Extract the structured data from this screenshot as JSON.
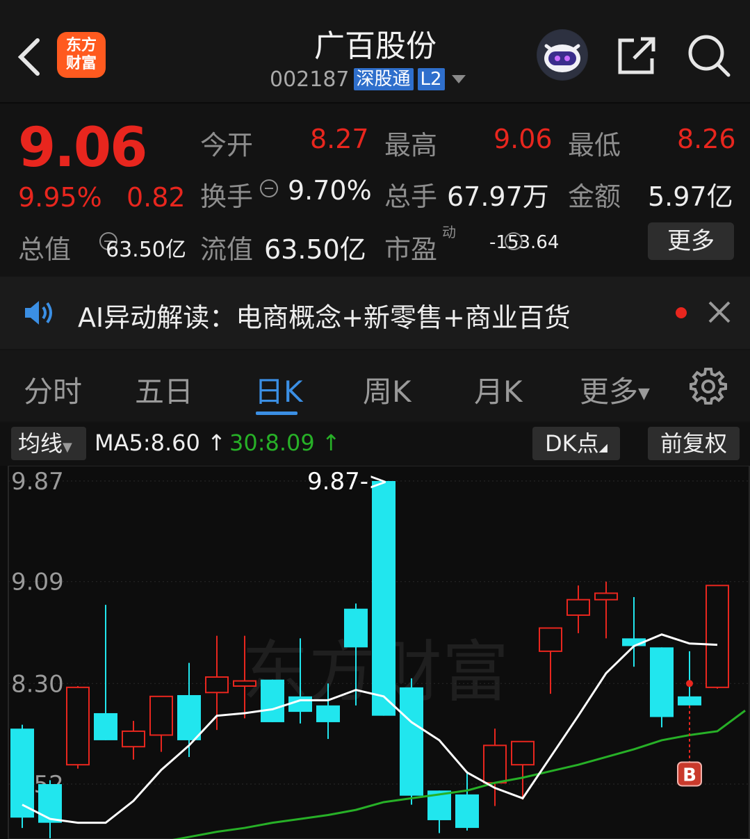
{
  "header": {
    "title": "广百股份",
    "code": "002187",
    "tag1": "深股通",
    "tag2": "L2",
    "logo_line1": "东方",
    "logo_line2": "财富"
  },
  "quote": {
    "price": "9.06",
    "change_pct": "9.95%",
    "change": "0.82",
    "open_label": "今开",
    "open": "8.27",
    "high_label": "最高",
    "high": "9.06",
    "low_label": "最低",
    "low": "8.26",
    "turnover_label": "换手",
    "turnover": "9.70%",
    "volume_label": "总手",
    "volume": "67.97万",
    "amount_label": "金额",
    "amount": "5.97亿",
    "mktcap_label": "总值",
    "mktcap": "63.50亿",
    "float_label": "流值",
    "float": "63.50亿",
    "pe_label": "市盈",
    "pe_sup": "动",
    "pe": "-153.64",
    "more": "更多"
  },
  "ai": {
    "text": "AI异动解读：电商概念+新零售+商业百货"
  },
  "tabs": [
    "分时",
    "五日",
    "日K",
    "周K",
    "月K",
    "更多"
  ],
  "indicators": {
    "ma_button": "均线",
    "ma5": "MA5:8.60 ↑",
    "ma30": "30:8.09 ↑",
    "dk": "DK点",
    "fq": "前复权"
  },
  "colors": {
    "up": "#e8261e",
    "down": "#21e6ee",
    "ma5": "#ffffff",
    "ma30": "#27b027",
    "accent": "#3b8fe4"
  },
  "chart_data": {
    "type": "candlestick",
    "y_ticks": [
      "9.87",
      "9.09",
      "8.30",
      "7.52"
    ],
    "ylim": [
      7.0,
      9.87
    ],
    "max_label": "9.87->",
    "signal": "B",
    "watermark": "东方财富",
    "candles": [
      {
        "o": 7.95,
        "h": 7.98,
        "l": 7.18,
        "c": 7.26
      },
      {
        "o": 7.52,
        "h": 7.55,
        "l": 7.1,
        "c": 7.22
      },
      {
        "o": 7.67,
        "h": 8.28,
        "l": 7.64,
        "c": 8.27
      },
      {
        "o": 8.07,
        "h": 8.91,
        "l": 7.87,
        "c": 7.86
      },
      {
        "o": 7.81,
        "h": 8.01,
        "l": 7.71,
        "c": 7.93
      },
      {
        "o": 7.9,
        "h": 8.18,
        "l": 7.77,
        "c": 8.2
      },
      {
        "o": 8.21,
        "h": 8.46,
        "l": 7.73,
        "c": 7.86
      },
      {
        "o": 8.23,
        "h": 8.67,
        "l": 7.94,
        "c": 8.35
      },
      {
        "o": 8.28,
        "h": 8.67,
        "l": 8.03,
        "c": 8.32
      },
      {
        "o": 8.33,
        "h": 8.33,
        "l": 8.24,
        "c": 8.0
      },
      {
        "o": 8.2,
        "h": 8.65,
        "l": 7.99,
        "c": 8.08
      },
      {
        "o": 8.13,
        "h": 8.3,
        "l": 7.87,
        "c": 8.0
      },
      {
        "o": 8.88,
        "h": 8.92,
        "l": 8.13,
        "c": 8.58
      },
      {
        "o": 9.87,
        "h": 9.87,
        "l": 8.05,
        "c": 8.05
      },
      {
        "o": 8.27,
        "h": 8.34,
        "l": 7.36,
        "c": 7.43
      },
      {
        "o": 7.47,
        "h": 7.4,
        "l": 7.14,
        "c": 7.24
      },
      {
        "o": 7.44,
        "h": 7.62,
        "l": 7.16,
        "c": 7.18
      },
      {
        "o": 7.53,
        "h": 7.95,
        "l": 7.35,
        "c": 7.82
      },
      {
        "o": 7.67,
        "h": 7.74,
        "l": 7.4,
        "c": 7.85
      },
      {
        "o": 8.55,
        "h": 8.55,
        "l": 8.22,
        "c": 8.73
      },
      {
        "o": 8.83,
        "h": 9.06,
        "l": 8.69,
        "c": 8.95
      },
      {
        "o": 8.95,
        "h": 9.09,
        "l": 8.65,
        "c": 9.0
      },
      {
        "o": 8.65,
        "h": 8.97,
        "l": 8.43,
        "c": 8.59
      },
      {
        "o": 8.58,
        "h": 8.56,
        "l": 7.96,
        "c": 8.04
      },
      {
        "o": 8.2,
        "h": 8.55,
        "l": 8.13,
        "c": 8.13
      },
      {
        "o": 8.27,
        "h": 9.05,
        "l": 8.26,
        "c": 9.06
      }
    ],
    "ma5": [
      7.36,
      7.25,
      7.22,
      7.22,
      7.39,
      7.63,
      7.82,
      8.05,
      8.07,
      8.1,
      8.17,
      8.17,
      8.25,
      8.2,
      8.0,
      7.86,
      7.61,
      7.49,
      7.41,
      7.73,
      8.05,
      8.38,
      8.59,
      8.68,
      8.61,
      8.6
    ],
    "ma30": [
      null,
      null,
      6.95,
      6.98,
      7.02,
      7.07,
      7.11,
      7.15,
      7.18,
      7.22,
      7.25,
      7.28,
      7.32,
      7.38,
      7.41,
      7.44,
      7.47,
      7.53,
      7.57,
      7.62,
      7.67,
      7.73,
      7.79,
      7.86,
      7.9,
      7.93,
      8.09
    ]
  }
}
